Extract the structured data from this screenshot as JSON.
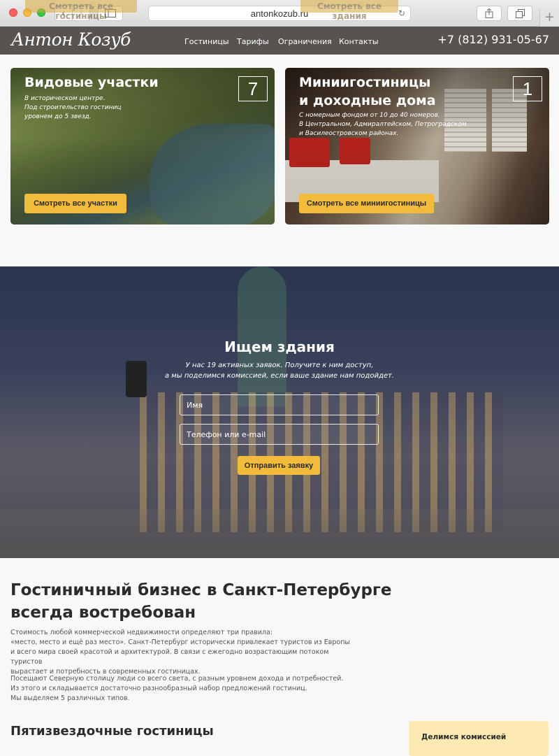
{
  "browser": {
    "url": "antonkozub.ru",
    "icons": [
      "back-icon",
      "forward-icon",
      "sidebar-icon",
      "reload-icon",
      "share-icon",
      "tabs-icon",
      "new-tab-icon"
    ]
  },
  "header": {
    "logo": "Антон Козуб",
    "nav": [
      "Гостиницы",
      "Тарифы",
      "Ограничения",
      "Контакты"
    ],
    "phone": "+7 (812) 931-05-67",
    "ghost_buttons": [
      "Смотреть все гостиницы",
      "Смотреть все здания"
    ]
  },
  "cards": [
    {
      "title": "Видовые участки",
      "desc": [
        "В историческом центре.",
        "Под строительство гостиниц",
        "уровнем до 5 звезд."
      ],
      "count": "7",
      "button": "Смотреть все участки"
    },
    {
      "title": [
        "Миниигостиницы",
        "и доходные дома"
      ],
      "desc": [
        "С номерным фондом от 10 до 40 номеров.",
        "В Центральном, Адмиралтейском, Петроградском",
        "и Василеостровском районах."
      ],
      "count": "1",
      "button": "Смотреть все миниигостиницы"
    }
  ],
  "request": {
    "title": "Ищем здания",
    "subtitle": [
      "У нас 19 активных заявок. Получите к ним доступ,",
      "а мы поделимся комиссией, если ваше здание нам подойдет."
    ],
    "name_placeholder": "Имя",
    "contact_placeholder": "Телефон или e-mail",
    "submit": "Отправить заявку"
  },
  "article": {
    "headline": [
      "Гостиничный бизнес в Санкт-Петербурге",
      "всегда востребован"
    ],
    "para1": [
      "Стоимость любой коммерческой недвижимости определяют три правила:",
      "«место, место и ещё раз место». Санкт-Петербург исторически привлекает туристов из Европы",
      "и всего мира своей красотой и архитектурой. В связи с ежегодно возрастающим потоком туристов",
      "вырастает и потребность в современных гостиницах."
    ],
    "para2": [
      "Посещают Северную столицу люди со всего света, с разным уровнем дохода и потребностей.",
      "Из этого и складывается достаточно разнообразный набор предложений гостиниц.",
      "Мы выделяем 5 различных типов."
    ],
    "subhead": "Пятизвездочные гостиницы",
    "commission": "Делимся комиссией"
  },
  "colors": {
    "accent": "#f3bb3c",
    "header_bg": "#3c3834",
    "commission_bg": "#fde9b2"
  }
}
